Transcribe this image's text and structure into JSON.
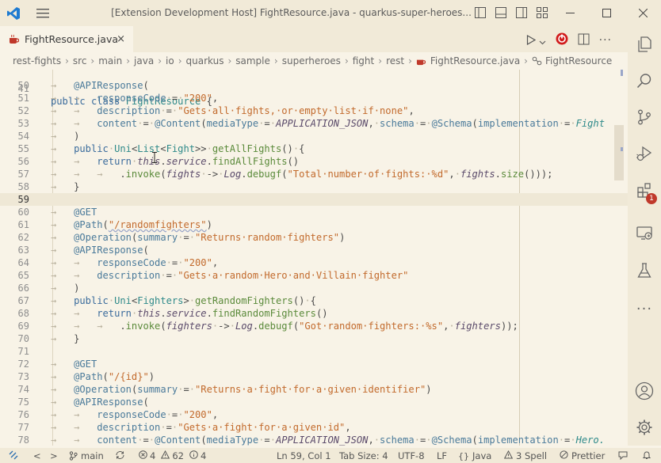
{
  "window": {
    "title": "[Extension Development Host] FightResource.java - quarkus-super-heroes..."
  },
  "tab": {
    "label": "FightResource.java",
    "close": "×"
  },
  "breadcrumbs": [
    "rest-fights",
    "src",
    "main",
    "java",
    "io",
    "quarkus",
    "sample",
    "superheroes",
    "fight",
    "rest",
    "FightResource.java",
    "FightResource"
  ],
  "editor": {
    "sticky_line": "41",
    "sticky_code": "public class FightResource {",
    "lines": [
      {
        "n": "50",
        "code": "@APIResponse("
      },
      {
        "n": "51",
        "code": "responseCode = \"200\","
      },
      {
        "n": "52",
        "code": "description = \"Gets all fights, or empty list if none\","
      },
      {
        "n": "53",
        "code": "content = @Content(mediaType = APPLICATION_JSON, schema = @Schema(implementation = Fight"
      },
      {
        "n": "54",
        "code": ")"
      },
      {
        "n": "55",
        "code": "public Uni<List<Fight>> getAllFights() {"
      },
      {
        "n": "56",
        "code": "return this.service.findAllFights()"
      },
      {
        "n": "57",
        "code": ".invoke(fights -> Log.debugf(\"Total number of fights: %d\", fights.size()));"
      },
      {
        "n": "58",
        "code": "}"
      },
      {
        "n": "59",
        "code": ""
      },
      {
        "n": "60",
        "code": "@GET"
      },
      {
        "n": "61",
        "code": "@Path(\"/randomfighters\")"
      },
      {
        "n": "62",
        "code": "@Operation(summary = \"Returns random fighters\")"
      },
      {
        "n": "63",
        "code": "@APIResponse("
      },
      {
        "n": "64",
        "code": "responseCode = \"200\","
      },
      {
        "n": "65",
        "code": "description = \"Gets a random Hero and Villain fighter\""
      },
      {
        "n": "66",
        "code": ")"
      },
      {
        "n": "67",
        "code": "public Uni<Fighters> getRandomFighters() {"
      },
      {
        "n": "68",
        "code": "return this.service.findRandomFighters()"
      },
      {
        "n": "69",
        "code": ".invoke(fighters -> Log.debugf(\"Got random fighters: %s\", fighters));"
      },
      {
        "n": "70",
        "code": "}"
      },
      {
        "n": "71",
        "code": ""
      },
      {
        "n": "72",
        "code": "@GET"
      },
      {
        "n": "73",
        "code": "@Path(\"/{id}\")"
      },
      {
        "n": "74",
        "code": "@Operation(summary = \"Returns a fight for a given identifier\")"
      },
      {
        "n": "75",
        "code": "@APIResponse("
      },
      {
        "n": "76",
        "code": "responseCode = \"200\","
      },
      {
        "n": "77",
        "code": "description = \"Gets a fight for a given id\","
      },
      {
        "n": "78",
        "code": "content = @Content(mediaType = APPLICATION_JSON, schema = @Schema(implementation = Hero."
      }
    ]
  },
  "activity": {
    "extensions_badge": "1"
  },
  "status": {
    "back": "<",
    "forward": ">",
    "branch": "main",
    "errors": "4",
    "warnings": "62",
    "info": "4",
    "position": "Ln 59, Col 1",
    "tab_size": "Tab Size: 4",
    "encoding": "UTF-8",
    "eol": "LF",
    "language": "Java",
    "spell": "3 Spell",
    "formatter": "Prettier"
  },
  "colors": {
    "background": "#f8f3e7",
    "chrome": "#f1ead8",
    "accent_blue": "#1e7bd1",
    "error_red": "#c0392b"
  }
}
